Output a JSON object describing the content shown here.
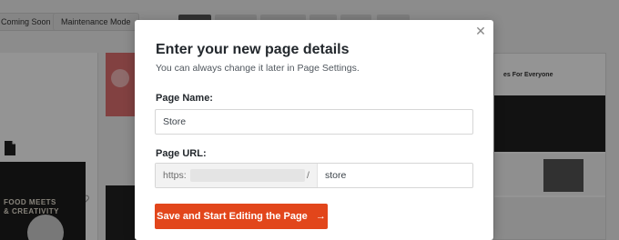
{
  "background": {
    "template_buttons": [
      "Coming Soon",
      "Maintenance Mode"
    ],
    "thumbnail_text": "FOOD MEETS\n& CREATIVITY",
    "preview_heading": "es For Everyone"
  },
  "modal": {
    "title": "Enter your new page details",
    "subtitle": "You can always change it later in Page Settings.",
    "close_icon": "close-icon",
    "page_name": {
      "label": "Page Name:",
      "value": "Store"
    },
    "page_url": {
      "label": "Page URL:",
      "prefix": "https:",
      "separator": "/",
      "slug": "store"
    },
    "save_button": {
      "label": "Save and Start Editing the Page",
      "arrow": "→",
      "color": "#e2461b"
    }
  }
}
